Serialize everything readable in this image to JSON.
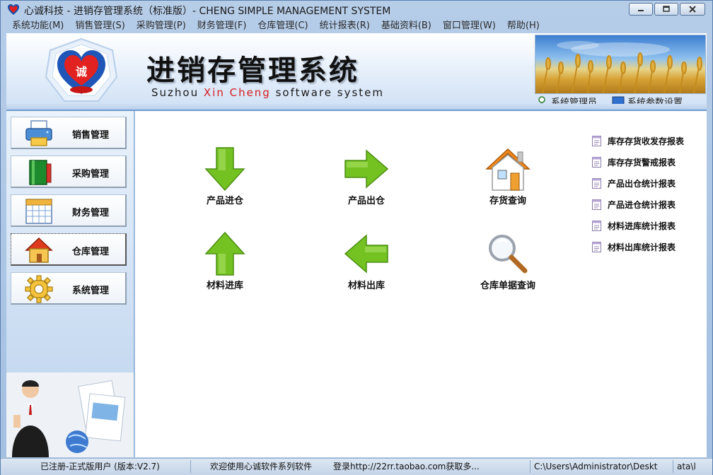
{
  "window": {
    "title": "心诚科技 - 进销存管理系统（标准版）- CHENG SIMPLE MANAGEMENT SYSTEM",
    "minimize_label": "minimize",
    "maximize_label": "maximize",
    "close_label": "close"
  },
  "menu": [
    {
      "label": "系统功能(M)"
    },
    {
      "label": "销售管理(S)"
    },
    {
      "label": "采购管理(P)"
    },
    {
      "label": "财务管理(F)"
    },
    {
      "label": "仓库管理(C)"
    },
    {
      "label": "统计报表(R)"
    },
    {
      "label": "基础资料(B)"
    },
    {
      "label": "窗口管理(W)"
    },
    {
      "label": "帮助(H)"
    }
  ],
  "banner": {
    "logo_text": "诚",
    "title": "进销存管理系统",
    "subtitle_prefix": "Suzhou ",
    "subtitle_highlight": "Xin Cheng",
    "subtitle_suffix": " software system",
    "links": [
      {
        "label": "系统管理员",
        "icon": "user-icon"
      },
      {
        "label": "系统参数设置",
        "icon": "monitor-icon"
      }
    ]
  },
  "sidebar": {
    "items": [
      {
        "label": "销售管理",
        "icon": "printer-icon"
      },
      {
        "label": "采购管理",
        "icon": "book-icon"
      },
      {
        "label": "财务管理",
        "icon": "calendar-icon"
      },
      {
        "label": "仓库管理",
        "icon": "house-icon"
      },
      {
        "label": "系统管理",
        "icon": "gear-icon"
      }
    ]
  },
  "functions": [
    {
      "label": "产品进仓",
      "icon": "arrow-down-icon"
    },
    {
      "label": "产品出仓",
      "icon": "arrow-right-icon"
    },
    {
      "label": "存货查询",
      "icon": "house-icon"
    },
    {
      "label": "材料进库",
      "icon": "arrow-up-icon"
    },
    {
      "label": "材料出库",
      "icon": "arrow-left-icon"
    },
    {
      "label": "仓库单据查询",
      "icon": "magnifier-icon"
    }
  ],
  "reports": [
    {
      "label": "库存存货收发存报表"
    },
    {
      "label": "库存存货警戒报表"
    },
    {
      "label": "产品出仓统计报表"
    },
    {
      "label": "产品进仓统计报表"
    },
    {
      "label": "材料进库统计报表"
    },
    {
      "label": "材料出库统计报表"
    }
  ],
  "status": {
    "license": "已注册-正式版用户 (版本:V2.7)",
    "welcome": "欢迎使用心诚软件系列软件",
    "login": "登录http://22rr.taobao.com获取多...",
    "path": "C:\\Users\\Administrator\\Deskt",
    "extra": "ata\\l"
  },
  "colors": {
    "accent_blue": "#6c9ad1",
    "arrow_green": "#6fbf1f",
    "brand_red": "#d81e1e"
  }
}
